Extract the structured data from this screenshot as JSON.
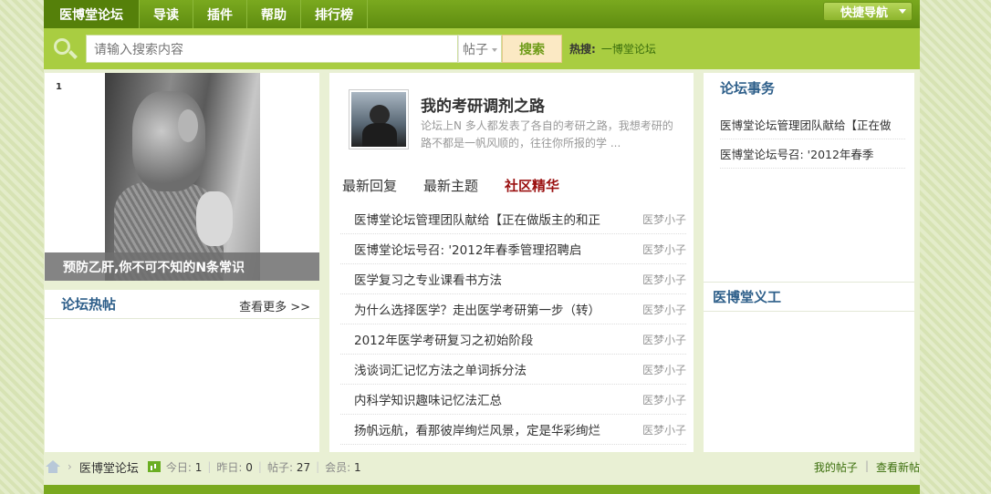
{
  "nav": {
    "items": [
      "医博堂论坛",
      "导读",
      "插件",
      "帮助",
      "排行榜"
    ],
    "active_index": 0,
    "quick_nav": "快捷导航"
  },
  "search": {
    "placeholder": "请输入搜索内容",
    "type": "帖子",
    "button": "搜索",
    "hot_label": "热搜:",
    "hot_links": [
      "一博堂论坛"
    ]
  },
  "slideshow": {
    "index": "1",
    "caption": "预防乙肝,你不可不知的N条常识"
  },
  "hot_posts": {
    "title": "论坛热帖",
    "more": "查看更多 >>"
  },
  "feature": {
    "title": "我的考研调剂之路",
    "desc": "论坛上N 多人都发表了各自的考研之路，我想考研的路不都是一帆风顺的，往往你所报的学 ..."
  },
  "tabs": [
    "最新回复",
    "最新主题",
    "社区精华"
  ],
  "active_tab": 2,
  "threads": [
    {
      "title": "医博堂论坛管理团队献给【正在做版主的和正",
      "author": "医梦小子"
    },
    {
      "title": "医博堂论坛号召: '2012年春季管理招聘启",
      "author": "医梦小子"
    },
    {
      "title": "医学复习之专业课看书方法",
      "author": "医梦小子"
    },
    {
      "title": "为什么选择医学？走出医学考研第一步（转）",
      "author": "医梦小子"
    },
    {
      "title": "2012年医学考研复习之初始阶段",
      "author": "医梦小子"
    },
    {
      "title": "浅谈词汇记忆方法之单词拆分法",
      "author": "医梦小子"
    },
    {
      "title": "内科学知识趣味记忆法汇总",
      "author": "医梦小子"
    },
    {
      "title": "扬帆远航，看那彼岸绚烂风景，定是华彩绚烂",
      "author": "医梦小子"
    }
  ],
  "affairs": {
    "title": "论坛事务",
    "items": [
      "医博堂论坛管理团队献给【正在做",
      "医博堂论坛号召: '2012年春季"
    ]
  },
  "volunteer": {
    "title": "医博堂义工"
  },
  "footer": {
    "crumb": "医博堂论坛",
    "stats": [
      {
        "label": "今日:",
        "value": "1"
      },
      {
        "label": "昨日:",
        "value": "0"
      },
      {
        "label": "帖子:",
        "value": "27"
      },
      {
        "label": "会员:",
        "value": "1"
      }
    ],
    "links": [
      "我的帖子",
      "查看新帖"
    ]
  },
  "colors": {
    "nav_green": "#6d9b17",
    "search_bar": "#a9cd41",
    "title_blue": "#2e5f8a",
    "active_tab_red": "#9a1010"
  }
}
